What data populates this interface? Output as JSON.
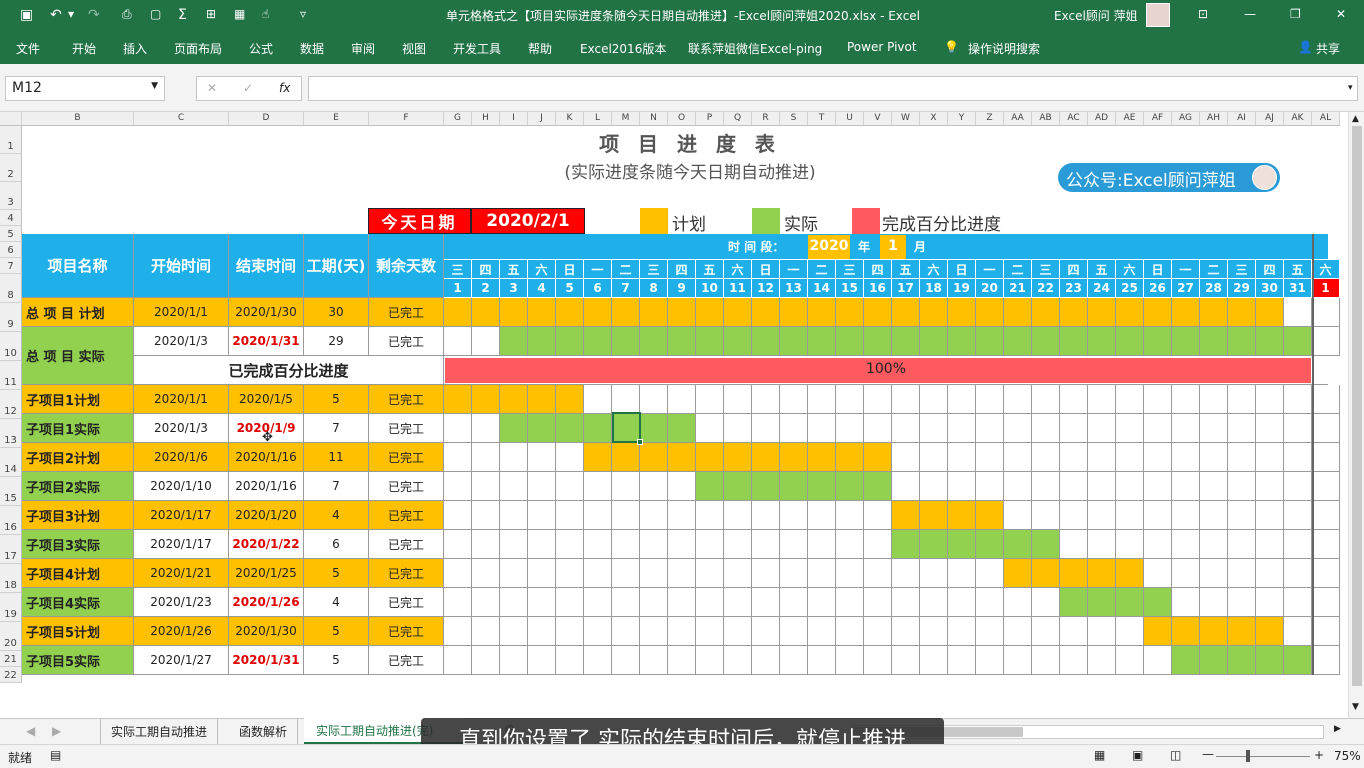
{
  "window": {
    "title": "单元格格式之【项目实际进度条随今天日期自动推进】-Excel顾问萍姐2020.xlsx  -  Excel",
    "user": "Excel顾问 萍姐",
    "controls": {
      "minimize": "—",
      "restore": "❐",
      "close": "✕",
      "ribbon_display": "⊡"
    }
  },
  "qat": {
    "save": "💾",
    "undo": "↶",
    "redo": "↷",
    "customize": "▾"
  },
  "menu": [
    "文件",
    "开始",
    "插入",
    "页面布局",
    "公式",
    "数据",
    "审阅",
    "视图",
    "开发工具",
    "帮助",
    "Excel2016版本",
    "联系萍姐微信Excel-ping",
    "Power Pivot",
    "操作说明搜索"
  ],
  "share": "共享",
  "formula_bar": {
    "name_box": "M12",
    "fx": "fx",
    "cancel": "✕",
    "enter": "✓",
    "value": ""
  },
  "columns": [
    "B",
    "C",
    "D",
    "E",
    "F",
    "G",
    "H",
    "I",
    "J",
    "K",
    "L",
    "M",
    "N",
    "O",
    "P",
    "Q",
    "R",
    "S",
    "T",
    "U",
    "V",
    "W",
    "X",
    "Y",
    "Z",
    "AA",
    "AB",
    "AC",
    "AD",
    "AE",
    "AF",
    "AG",
    "AH",
    "AI",
    "AJ",
    "AK",
    "AL"
  ],
  "rows": [
    "1",
    "2",
    "3",
    "4",
    "5",
    "6",
    "7",
    "8",
    "9",
    "10",
    "11",
    "12",
    "13",
    "14",
    "15",
    "16",
    "17",
    "18",
    "19",
    "20",
    "21",
    "22"
  ],
  "sheet": {
    "title": "项 目 进 度 表",
    "subtitle": "(实际进度条随今天日期自动推进)",
    "badge": "公众号:Excel顾问萍姐",
    "today_label": "今天日期",
    "today_value": "2020/2/1",
    "legend": {
      "plan": "计划",
      "actual": "实际",
      "percent": "完成百分比进度"
    },
    "headers": {
      "name": "项目名称",
      "start": "开始时间",
      "end": "结束时间",
      "duration": "工期(天)",
      "remaining": "剩余天数"
    },
    "period": {
      "label": "时 间 段：",
      "year": "2020",
      "year_unit": "年",
      "month": "1",
      "month_unit": "月"
    },
    "weekdays": [
      "三",
      "四",
      "五",
      "六",
      "日",
      "一",
      "二",
      "三",
      "四",
      "五",
      "六",
      "日",
      "一",
      "二",
      "三",
      "四",
      "五",
      "六",
      "日",
      "一",
      "二",
      "三",
      "四",
      "五",
      "六",
      "日",
      "一",
      "二",
      "三",
      "四",
      "五",
      "六"
    ],
    "days": [
      "1",
      "2",
      "3",
      "4",
      "5",
      "6",
      "7",
      "8",
      "9",
      "10",
      "11",
      "12",
      "13",
      "14",
      "15",
      "16",
      "17",
      "18",
      "19",
      "20",
      "21",
      "22",
      "23",
      "24",
      "25",
      "26",
      "27",
      "28",
      "29",
      "30",
      "31",
      "1"
    ],
    "percent_label": "已完成百分比进度",
    "percent_value": "100%",
    "rows": [
      {
        "name": "总 项 目 计划",
        "start": "2020/1/1",
        "end": "2020/1/30",
        "duration": "30",
        "remaining": "已完工",
        "type": "plan",
        "from": 1,
        "to": 30,
        "end_red": false
      },
      {
        "name": "总 项 目 实际",
        "start": "2020/1/3",
        "end": "2020/1/31",
        "duration": "29",
        "remaining": "已完工",
        "type": "actual",
        "from": 3,
        "to": 31,
        "end_red": true
      },
      {
        "name": "子项目1计划",
        "start": "2020/1/1",
        "end": "2020/1/5",
        "duration": "5",
        "remaining": "已完工",
        "type": "plan",
        "from": 1,
        "to": 5,
        "end_red": false
      },
      {
        "name": "子项目1实际",
        "start": "2020/1/3",
        "end": "2020/1/9",
        "duration": "7",
        "remaining": "已完工",
        "type": "actual",
        "from": 3,
        "to": 9,
        "end_red": true
      },
      {
        "name": "子项目2计划",
        "start": "2020/1/6",
        "end": "2020/1/16",
        "duration": "11",
        "remaining": "已完工",
        "type": "plan",
        "from": 6,
        "to": 16,
        "end_red": false
      },
      {
        "name": "子项目2实际",
        "start": "2020/1/10",
        "end": "2020/1/16",
        "duration": "7",
        "remaining": "已完工",
        "type": "actual",
        "from": 10,
        "to": 16,
        "end_red": false
      },
      {
        "name": "子项目3计划",
        "start": "2020/1/17",
        "end": "2020/1/20",
        "duration": "4",
        "remaining": "已完工",
        "type": "plan",
        "from": 17,
        "to": 20,
        "end_red": false
      },
      {
        "name": "子项目3实际",
        "start": "2020/1/17",
        "end": "2020/1/22",
        "duration": "6",
        "remaining": "已完工",
        "type": "actual",
        "from": 17,
        "to": 22,
        "end_red": true
      },
      {
        "name": "子项目4计划",
        "start": "2020/1/21",
        "end": "2020/1/25",
        "duration": "5",
        "remaining": "已完工",
        "type": "plan",
        "from": 21,
        "to": 25,
        "end_red": false
      },
      {
        "name": "子项目4实际",
        "start": "2020/1/23",
        "end": "2020/1/26",
        "duration": "4",
        "remaining": "已完工",
        "type": "actual",
        "from": 23,
        "to": 26,
        "end_red": true
      },
      {
        "name": "子项目5计划",
        "start": "2020/1/26",
        "end": "2020/1/30",
        "duration": "5",
        "remaining": "已完工",
        "type": "plan",
        "from": 26,
        "to": 30,
        "end_red": false
      },
      {
        "name": "子项目5实际",
        "start": "2020/1/27",
        "end": "2020/1/31",
        "duration": "5",
        "remaining": "已完工",
        "type": "actual",
        "from": 27,
        "to": 31,
        "end_red": true
      }
    ]
  },
  "tabs": [
    "实际工期自动推进",
    "函数解析",
    "实际工期自动推进(完)"
  ],
  "subtitle_caption": "直到你设置了 实际的结束时间后，就停止推进",
  "status": {
    "ready": "就绪",
    "zoom": "75%"
  },
  "colors": {
    "excel_green": "#217346",
    "plan": "#ffc000",
    "actual": "#92d050",
    "percent": "#ff5a5f",
    "header_blue": "#1fb0ea",
    "today_red": "#ff0000"
  }
}
